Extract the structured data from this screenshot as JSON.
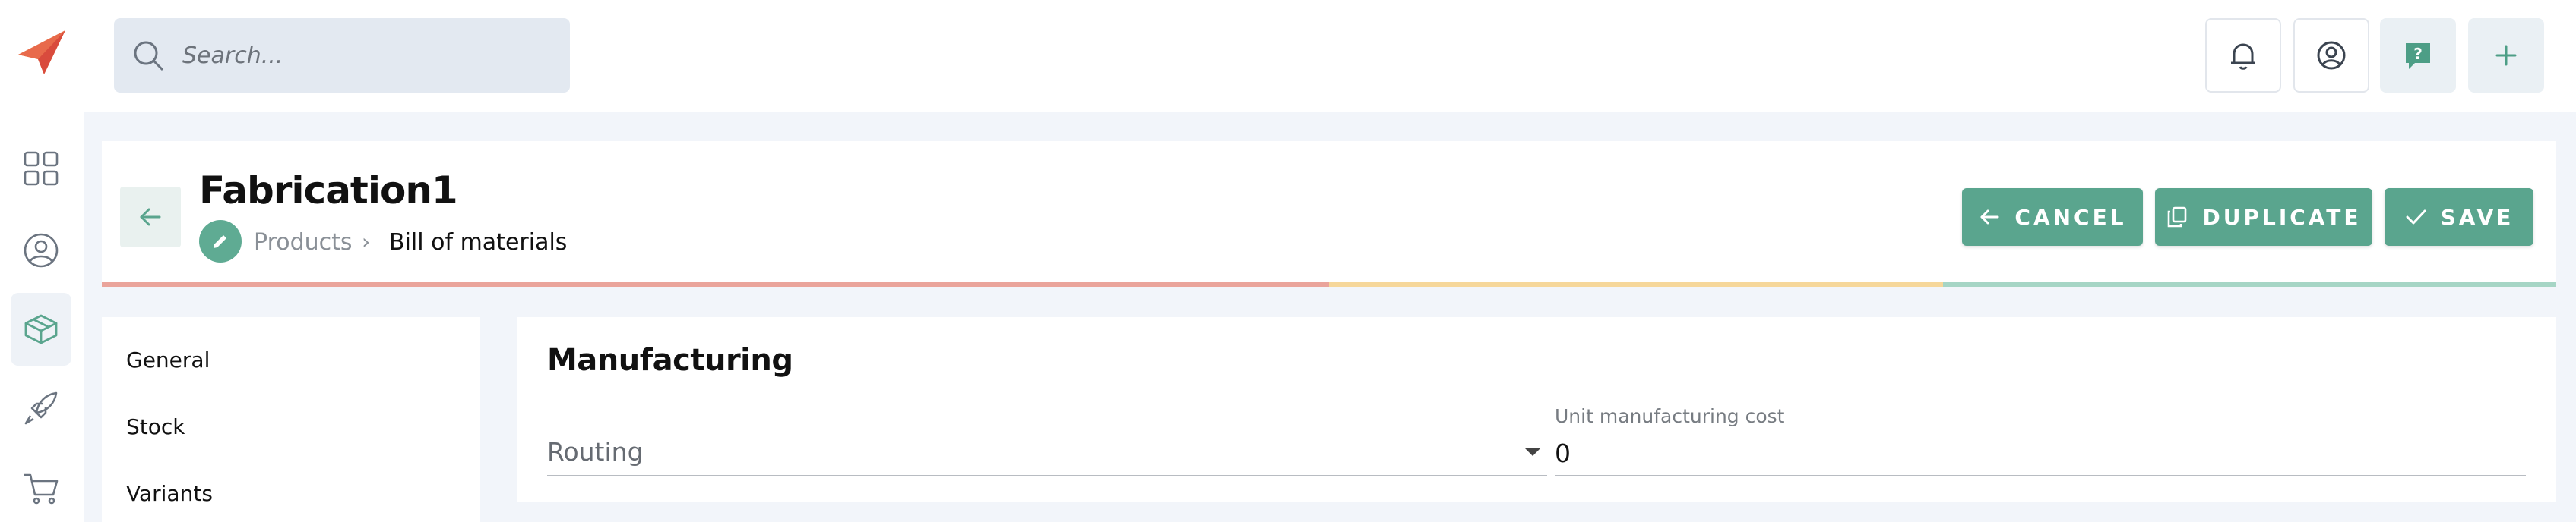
{
  "app": {
    "logo_icon": "paper-plane-logo",
    "accent_color": "#5aa58e"
  },
  "rail": {
    "items": [
      {
        "icon": "grid-icon",
        "active": false
      },
      {
        "icon": "user-circle-icon",
        "active": false
      },
      {
        "icon": "box-icon",
        "active": true
      },
      {
        "icon": "rocket-icon",
        "active": false
      },
      {
        "icon": "cart-icon",
        "active": false
      }
    ]
  },
  "search": {
    "placeholder": "Search..."
  },
  "topbar": {
    "buttons": [
      "bell-icon",
      "account-icon",
      "help-icon",
      "plus-icon"
    ]
  },
  "header": {
    "title": "Fabrication1",
    "breadcrumb": [
      "Products",
      "Bill of materials"
    ],
    "breadcrumb_separator": "›",
    "actions": {
      "cancel": "CANCEL",
      "duplicate": "DUPLICATE",
      "save": "SAVE"
    },
    "progress_colors": [
      "#eaa49b",
      "#eaa49b",
      "#f6d79a",
      "#a6d5c5"
    ]
  },
  "nav": {
    "items": [
      "General",
      "Stock",
      "Variants"
    ]
  },
  "main": {
    "section_title": "Manufacturing",
    "routing": {
      "placeholder": "Routing",
      "value": ""
    },
    "unit_cost": {
      "label": "Unit manufacturing cost",
      "value": "0"
    }
  }
}
